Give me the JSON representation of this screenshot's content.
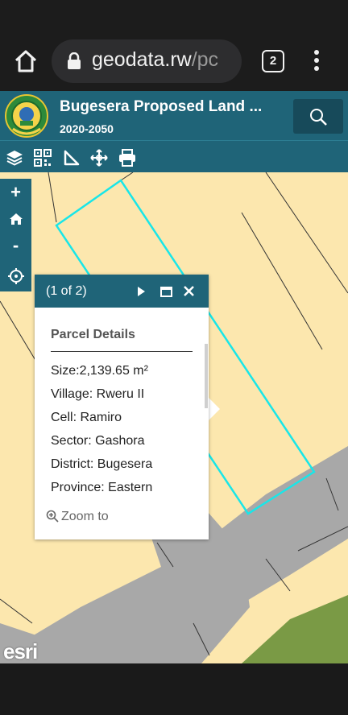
{
  "browser": {
    "url_main": "geodata.rw",
    "url_rest": "/pc",
    "tab_count": "2"
  },
  "app": {
    "title": "Bugesera Proposed Land ...",
    "subtitle": "2020-2050"
  },
  "toolbar": {
    "tools": [
      "layers-icon",
      "qr-code-icon",
      "measure-icon",
      "move-icon",
      "print-icon"
    ]
  },
  "map_controls": {
    "zoom_in": "+",
    "zoom_out": "-"
  },
  "popup": {
    "count": "(1 of 2)",
    "title": "Parcel Details",
    "size": "Size:2,139.65 m²",
    "village": "Village: Rweru II",
    "cell": "Cell: Ramiro",
    "sector": "Sector: Gashora",
    "district": "District: Bugesera",
    "province": "Province: Eastern",
    "zoom_to": "Zoom to"
  },
  "attribution": "esri",
  "colors": {
    "header": "#1f6478",
    "land": "#fce7ae",
    "road": "#a6a6a6",
    "parcel_highlight": "#19e6e8",
    "vegetation": "#7a9a45"
  }
}
